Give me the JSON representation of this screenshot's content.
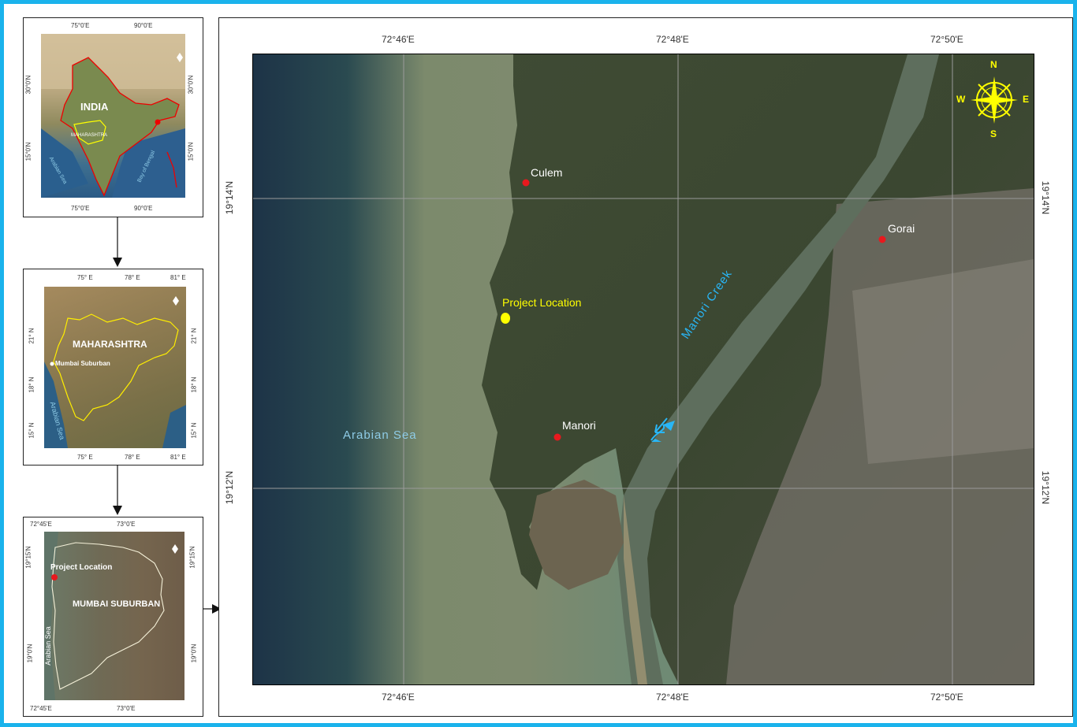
{
  "inset1": {
    "ticks_top": [
      "75°0'E",
      "90°0'E"
    ],
    "ticks_bottom": [
      "75°0'E",
      "90°0'E"
    ],
    "ticks_left": [
      "30°0'N",
      "15°0'N"
    ],
    "ticks_right": [
      "30°0'N",
      "15°0'N"
    ],
    "country_label": "INDIA",
    "state_label": "MAHARASHTRA",
    "sea_left": "Arabian Sea",
    "sea_right": "Bay of Bengal"
  },
  "inset2": {
    "ticks_top": [
      "75° E",
      "78° E",
      "81° E"
    ],
    "ticks_bottom": [
      "75° E",
      "78° E",
      "81° E"
    ],
    "ticks_left": [
      "21° N",
      "18° N",
      "15° N"
    ],
    "ticks_right": [
      "21° N",
      "18° N",
      "15° N"
    ],
    "state_label": "MAHARASHTRA",
    "district_label": "Mumbai Suburban",
    "sea_label": "Arabian Sea"
  },
  "inset3": {
    "ticks_top": [
      "72°45'E",
      "73°0'E"
    ],
    "ticks_bottom": [
      "72°45'E",
      "73°0'E"
    ],
    "ticks_left": [
      "19°15'N",
      "19°0'N"
    ],
    "ticks_right": [
      "19°15'N",
      "19°0'N"
    ],
    "project_label": "Project Location",
    "district_label": "MUMBAI SUBURBAN",
    "sea_label": "Arabian Sea"
  },
  "main": {
    "ticks_top": [
      "72°46'E",
      "72°48'E",
      "72°50'E"
    ],
    "ticks_bottom": [
      "72°46'E",
      "72°48'E",
      "72°50'E"
    ],
    "ticks_left": [
      "19°14'N",
      "19°12'N"
    ],
    "ticks_right": [
      "19°14'N",
      "19°12'N"
    ],
    "places": {
      "culem": "Culem",
      "gorai": "Gorai",
      "manori": "Manori",
      "project": "Project Location",
      "creek": "Manori Creek",
      "sea": "Arabian Sea"
    },
    "compass": {
      "n": "N",
      "s": "S",
      "e": "E",
      "w": "W"
    }
  },
  "colors": {
    "frame": "#1ab3ec",
    "red_marker": "#e8191e",
    "project_marker": "#ffff00",
    "water_label": "#8ecbe6",
    "creek_label": "#29b6f6"
  }
}
